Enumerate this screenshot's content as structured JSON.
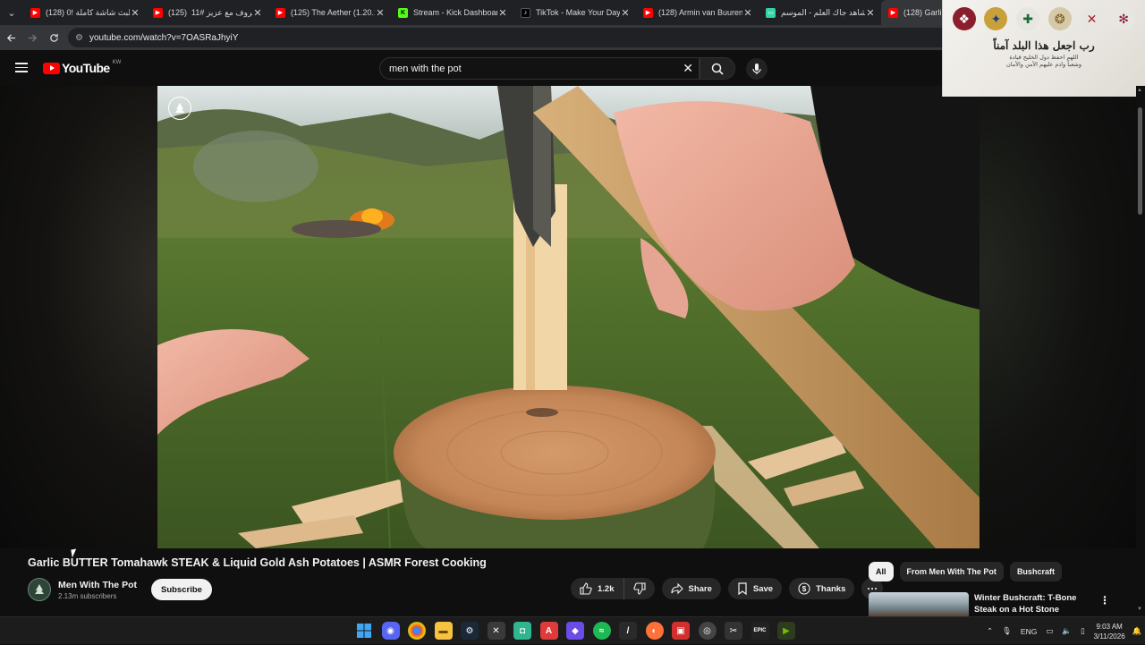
{
  "browser": {
    "tabs": [
      {
        "label": "(128) البث شاشة كاملة ‏!0",
        "favicon": "youtube-icon",
        "color": "#ff0000"
      },
      {
        "label": "(125) حروف مع عزيز #11 ‏",
        "favicon": "youtube-icon",
        "color": "#ff0000"
      },
      {
        "label": "(125) The Aether (1.20.1)",
        "favicon": "youtube-icon",
        "color": "#ff0000"
      },
      {
        "label": "Stream - Kick Dashboard",
        "favicon": "kick-icon",
        "color": "#53fc18"
      },
      {
        "label": "TikTok - Make Your Day",
        "favicon": "tiktok-icon",
        "color": "#000000"
      },
      {
        "label": "(128) Armin van Buuren -",
        "favicon": "youtube-icon",
        "color": "#ff0000"
      },
      {
        "label": "شاهد جاك العلم - الموسم",
        "favicon": "shahid-icon",
        "color": "#34d3a7"
      },
      {
        "label": "(128) Garli",
        "favicon": "youtube-icon",
        "color": "#ff0000"
      }
    ],
    "url": "youtube.com/watch?v=7OASRaJhyiY"
  },
  "youtube": {
    "logo_text": "YouTube",
    "country_code": "KW",
    "search_value": "men with the pot"
  },
  "overlay": {
    "main_text": "رب اجعل هذا البلد آمناً",
    "sub_line1": "اللهم احفظ دول الخليج قيادة",
    "sub_line2": "وشعباً وادم عليهم الأمن والأمان"
  },
  "video": {
    "title": "Garlic BUTTER Tomahawk STEAK & Liquid Gold Ash Potatoes | ASMR Forest Cooking",
    "channel_name": "Men With The Pot",
    "subscribers": "2.13m subscribers",
    "subscribe_label": "Subscribe",
    "like_count": "1.2k",
    "share_label": "Share",
    "save_label": "Save",
    "thanks_label": "Thanks"
  },
  "sidebar": {
    "chips": [
      "All",
      "From Men With The Pot",
      "Bushcraft"
    ],
    "rec_title": "Winter Bushcraft: T-Bone Steak on a Hot Stone"
  },
  "taskbar": {
    "language": "ENG",
    "time": "9:03 AM",
    "date": "3/11/2026"
  },
  "colors": {
    "accent": "#ff0000",
    "background": "#0f0f0f",
    "pill": "#272727"
  }
}
